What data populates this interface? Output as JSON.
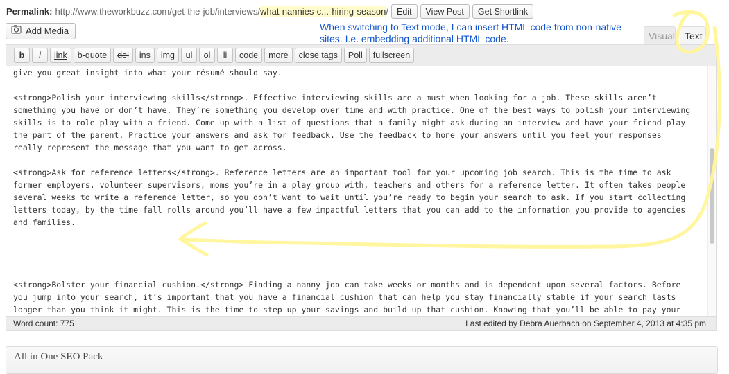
{
  "permalink": {
    "label": "Permalink:",
    "url_base": "http://www.theworkbuzz.com/get-the-job/interviews/",
    "slug": "what-nannies-c...-hiring-season",
    "url_trail": "/",
    "buttons": {
      "edit": "Edit",
      "view": "View Post",
      "shortlink": "Get Shortlink"
    }
  },
  "media": {
    "add_label": "Add Media"
  },
  "annotation": {
    "note": "When switching to Text mode, I can insert HTML code from non-native sites. I.e. embedding additional HTML code."
  },
  "tabs": {
    "visual": "Visual",
    "text": "Text",
    "active": "text"
  },
  "toolbar": {
    "buttons": [
      "b",
      "i",
      "link",
      "b-quote",
      "del",
      "ins",
      "img",
      "ul",
      "ol",
      "li",
      "code",
      "more",
      "close tags",
      "Poll",
      "fullscreen"
    ]
  },
  "content": {
    "lines": [
      "give you great insight into what your résumé should say.",
      "",
      "<strong>Polish your interviewing skills</strong>. Effective interviewing skills are a must when looking for a job. These skills aren’t",
      "something you have or don’t have. They’re something you develop over time and with practice. One of the best ways to polish your interviewing",
      "skills is to role play with a friend. Come up with a list of questions that a family might ask during an interview and have your friend play",
      "the part of the parent. Practice your answers and ask for feedback. Use the feedback to hone your answers until you feel your responses",
      "really represent the message that you want to get across.",
      "",
      "<strong>Ask for reference letters</strong>. Reference letters are an important tool for your upcoming job search. This is the time to ask",
      "former employers, volunteer supervisors, moms you’re in a play group with, teachers and others for a reference letter. It often takes people",
      "several weeks to write a reference letter, so you don’t want to wait until you’re ready to begin your search to ask. If you start collecting",
      "letters today, by the time fall rolls around you’ll have a few impactful letters that you can add to the information you provide to agencies",
      "and families.",
      "<strong>Bolster your financial cushion.</strong> Finding a nanny job can take weeks or months and is dependent upon several factors. Before",
      "you jump into your search, it’s important that you have a financial cushion that can help you stay financially stable if your search lasts",
      "longer than you think it might. This is the time to step up your savings and build up that cushion. Knowing that you’ll be able to pay your"
    ]
  },
  "status": {
    "word_count": "Word count: 775",
    "last_edited": "Last edited by Debra Auerbach on September 4, 2013 at 4:35 pm"
  },
  "seo": {
    "title": "All in One SEO Pack"
  },
  "colors": {
    "note": "#1155cc",
    "highlight": "#fff59a",
    "slug_bg": "#fffbcc"
  }
}
